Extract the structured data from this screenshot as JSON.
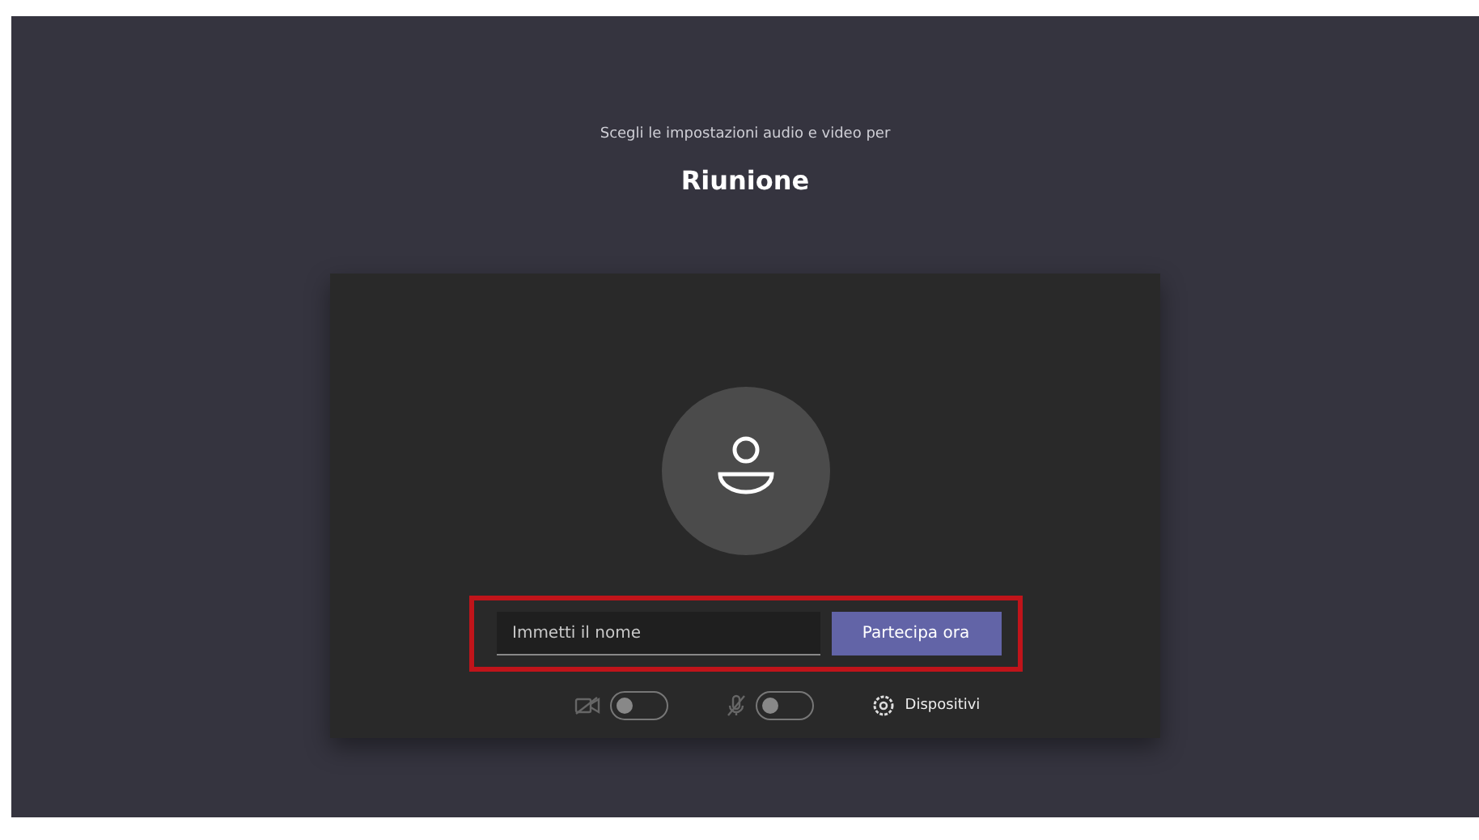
{
  "subtitle": "Scegli le impostazioni audio e video per",
  "title": "Riunione",
  "name_field": {
    "placeholder": "Immetti il nome"
  },
  "join_button": "Partecipa ora",
  "toggles": [
    {
      "kind": "camera",
      "on": false
    },
    {
      "kind": "mic",
      "on": false
    }
  ],
  "devices_button": "Dispositivi"
}
